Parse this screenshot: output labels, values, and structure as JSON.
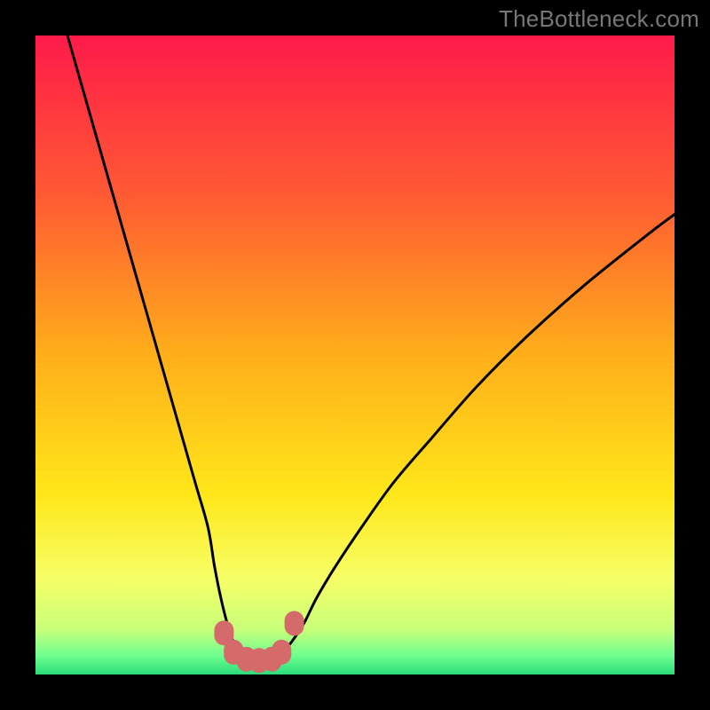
{
  "watermark": "TheBottleneck.com",
  "colors": {
    "page_bg": "#000000",
    "curve": "#000000",
    "marker": "#d46a6a",
    "gradient_stops": [
      {
        "offset": 0.0,
        "color": "#ff1a4a"
      },
      {
        "offset": 0.25,
        "color": "#ff5a33"
      },
      {
        "offset": 0.5,
        "color": "#ffae1a"
      },
      {
        "offset": 0.72,
        "color": "#ffe71a"
      },
      {
        "offset": 0.85,
        "color": "#f6ff66"
      },
      {
        "offset": 0.93,
        "color": "#c8ff7a"
      },
      {
        "offset": 0.97,
        "color": "#6fff8f"
      },
      {
        "offset": 1.0,
        "color": "#2bdc7b"
      }
    ]
  },
  "chart_data": {
    "type": "line",
    "title": "",
    "xlabel": "",
    "ylabel": "",
    "xlim": [
      0,
      100
    ],
    "ylim": [
      0,
      100
    ],
    "series": [
      {
        "name": "left-branch",
        "x": [
          5,
          7,
          9,
          11,
          13,
          15,
          17,
          19,
          21,
          23,
          25,
          27,
          28,
          29,
          30,
          31,
          32,
          33
        ],
        "values": [
          100,
          93,
          86,
          79,
          72,
          65,
          58,
          51,
          44,
          37,
          30,
          23,
          17,
          12,
          8,
          5,
          3,
          2
        ]
      },
      {
        "name": "right-branch",
        "x": [
          37,
          38,
          39,
          40,
          42,
          44,
          47,
          51,
          56,
          62,
          69,
          77,
          86,
          96,
          100
        ],
        "values": [
          2,
          3,
          4,
          5,
          8,
          12,
          17,
          23,
          30,
          37,
          45,
          53,
          61,
          69,
          72
        ]
      },
      {
        "name": "trough-markers",
        "x": [
          29.5,
          31,
          33,
          35,
          37,
          38.5,
          40.5
        ],
        "values": [
          6.5,
          3.5,
          2.4,
          2.2,
          2.4,
          3.5,
          8
        ]
      }
    ]
  }
}
